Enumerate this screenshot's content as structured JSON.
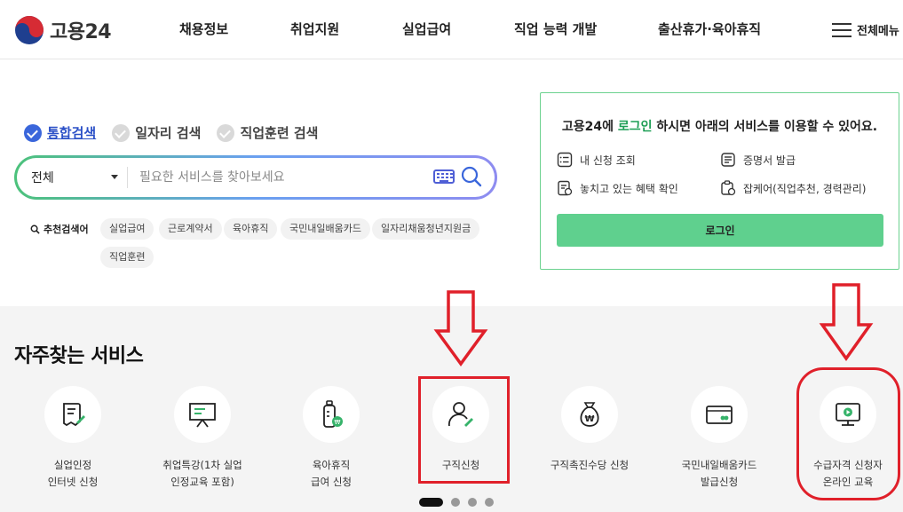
{
  "header": {
    "logo_text": "고용24",
    "nav": [
      {
        "label": "채용정보"
      },
      {
        "label": "취업지원"
      },
      {
        "label": "실업급여"
      },
      {
        "label": "직업 능력 개발"
      },
      {
        "label": "출산휴가·육아휴직"
      }
    ],
    "menu_all": "전체메뉴"
  },
  "search": {
    "tabs": [
      {
        "label": "통합검색",
        "active": true
      },
      {
        "label": "일자리 검색",
        "active": false
      },
      {
        "label": "직업훈련 검색",
        "active": false
      }
    ],
    "scope": "전체",
    "placeholder": "필요한 서비스를 찾아보세요",
    "recommend_label": "추천검색어",
    "keywords": [
      "실업급여",
      "근로계약서",
      "육아휴직",
      "국민내일배움카드",
      "일자리채움청년지원금",
      "직업훈련"
    ]
  },
  "login": {
    "msg_pre": "고용24에 ",
    "msg_hl": "로그인",
    "msg_post": " 하시면 아래의 서비스를 이용할 수 있어요.",
    "services": [
      {
        "label": "내 신청 조회",
        "icon": "checklist-icon"
      },
      {
        "label": "증명서 발급",
        "icon": "certificate-icon"
      },
      {
        "label": "놓치고 있는 혜택 확인",
        "icon": "benefit-icon"
      },
      {
        "label": "잡케어(직업추천, 경력관리)",
        "icon": "jobcare-icon"
      }
    ],
    "button": "로그인"
  },
  "services": {
    "title": "자주찾는 서비스",
    "items": [
      {
        "label": "실업인정\n인터넷 신청",
        "icon": "document-pen-icon"
      },
      {
        "label": "취업특강(1차 실업\n인정교육 포함)",
        "icon": "presentation-board-icon"
      },
      {
        "label": "육아휴직\n급여 신청",
        "icon": "baby-bottle-icon"
      },
      {
        "label": "구직신청",
        "icon": "person-pen-icon"
      },
      {
        "label": "구직촉진수당 신청",
        "icon": "money-bag-icon"
      },
      {
        "label": "국민내일배움카드\n발급신청",
        "icon": "card-icon"
      },
      {
        "label": "수급자격 신청자\n온라인 교육",
        "icon": "monitor-play-icon"
      }
    ]
  },
  "colors": {
    "accent_green": "#5fd08e",
    "accent_blue": "#3a66db",
    "annotation_red": "#e0202a"
  }
}
